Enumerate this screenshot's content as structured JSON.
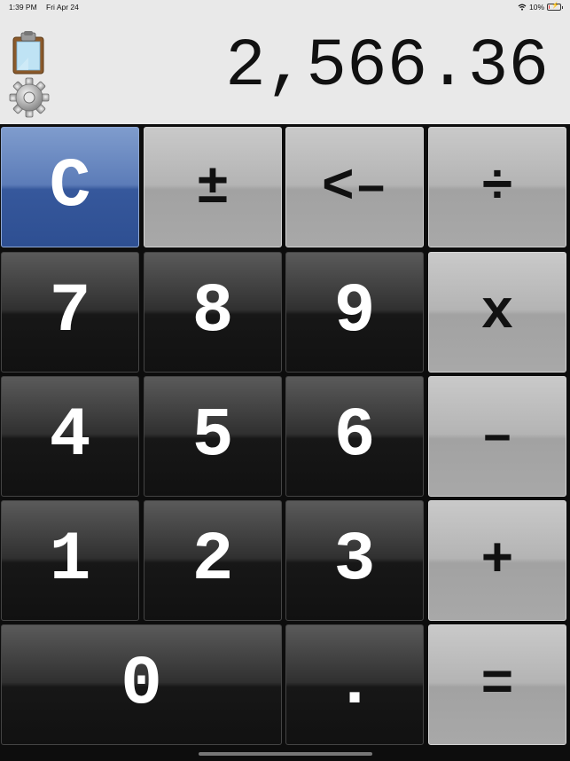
{
  "status_bar": {
    "time": "1:39 PM",
    "date": "Fri Apr 24",
    "battery": "10%",
    "battery_level": 0.1,
    "icons": [
      "wifi-icon",
      "battery-icon",
      "charging-icon"
    ]
  },
  "display": {
    "value": "2,566.36"
  },
  "toolbar": {
    "icons": [
      "clipboard-icon",
      "gear-icon"
    ]
  },
  "keys": {
    "clear": "C",
    "plus_minus": "±",
    "backspace": "<–",
    "divide": "÷",
    "seven": "7",
    "eight": "8",
    "nine": "9",
    "multiply": "x",
    "four": "4",
    "five": "5",
    "six": "6",
    "minus": "–",
    "one": "1",
    "two": "2",
    "three": "3",
    "plus": "+",
    "zero": "0",
    "decimal": ".",
    "equals": "="
  },
  "colors": {
    "clear_key": "#3b5fa3",
    "digit_key": "#1a1a1a",
    "operator_key": "#aaaaaa",
    "background": "#e9e9e9"
  }
}
